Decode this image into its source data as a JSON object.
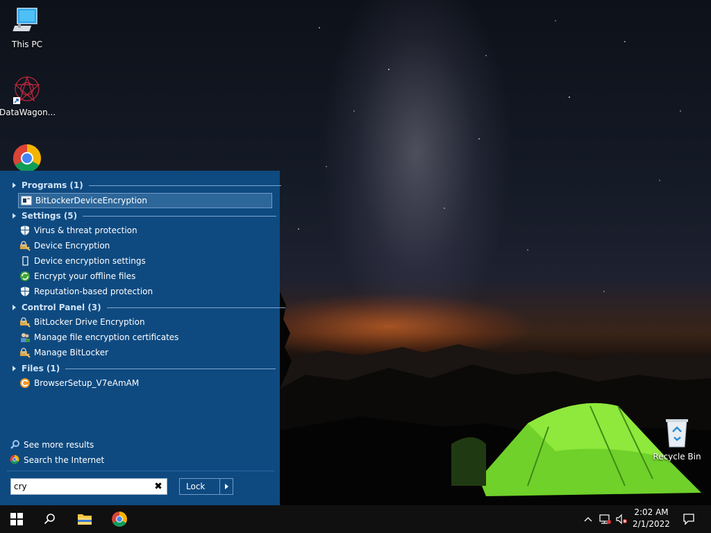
{
  "desktop": {
    "icons": [
      {
        "label": "This PC",
        "icon": "computer-icon"
      },
      {
        "label": "DataWagon...",
        "icon": "datawagon-icon"
      },
      {
        "label": "Google Chrome",
        "icon": "chrome-icon"
      },
      {
        "label": "Recycle Bin",
        "icon": "recycle-bin-icon"
      }
    ]
  },
  "search_panel": {
    "groups": {
      "programs": "Programs (1)",
      "settings": "Settings (5)",
      "control_panel": "Control Panel (3)",
      "files": "Files (1)"
    },
    "items": {
      "bitlocker_device_encryption": "BitLockerDeviceEncryption",
      "virus_threat": "Virus & threat protection",
      "device_encryption": "Device Encryption",
      "device_encryption_settings": "Device encryption settings",
      "encrypt_offline": "Encrypt your offline files",
      "reputation": "Reputation-based protection",
      "bitlocker_drive": "BitLocker Drive Encryption",
      "manage_certs": "Manage file encryption certificates",
      "manage_bitlocker": "Manage BitLocker",
      "browser_setup": "BrowserSetup_V7eAmAM"
    },
    "see_more": "See more results",
    "search_internet": "Search the Internet",
    "search_value": "cry",
    "clear_symbol": "✖",
    "lock_label": "Lock"
  },
  "taskbar": {
    "time": "2:02 AM",
    "date": "2/1/2022"
  },
  "colors": {
    "panel": "#0e4a80",
    "taskbar": "#101010",
    "accent": "#2d6699"
  }
}
